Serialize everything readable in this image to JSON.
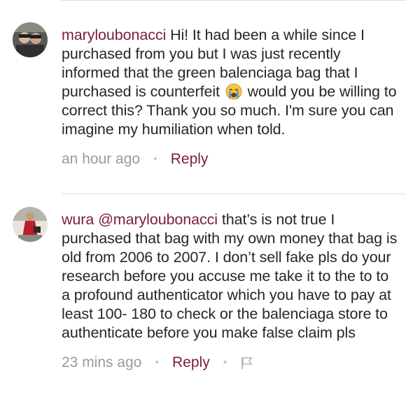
{
  "comments": [
    {
      "username": "maryloubonacci",
      "text_before_emoji": "Hi! It had been a while since I purchased from you but I was just recently informed that the green balenciaga bag that I purchased is counterfeit",
      "emoji_icon": "crying-face-emoji",
      "text_after_emoji": "would you be willing to correct this? Thank you so much. I'm sure you can imagine my humiliation when told.",
      "time": "an hour ago",
      "dot": "•",
      "reply_label": "Reply"
    },
    {
      "username": "wura",
      "mention": "@maryloubonacci",
      "text": "that’s is not true I purchased that bag with my own money that bag is old from 2006 to 2007. I don’t sell fake pls do your research before you accuse me take it to the to to a profound authenticator which you have to pay at least 100- 180 to check or the balenciaga store to authenticate before you make false claim pls",
      "time": "23 mins ago",
      "dot": "•",
      "reply_label": "Reply",
      "flag_icon": "flag-icon"
    }
  ],
  "colors": {
    "username": "#7a1f35",
    "text": "#262626",
    "muted": "#9a9a9a",
    "divider": "#dcdcdc"
  }
}
